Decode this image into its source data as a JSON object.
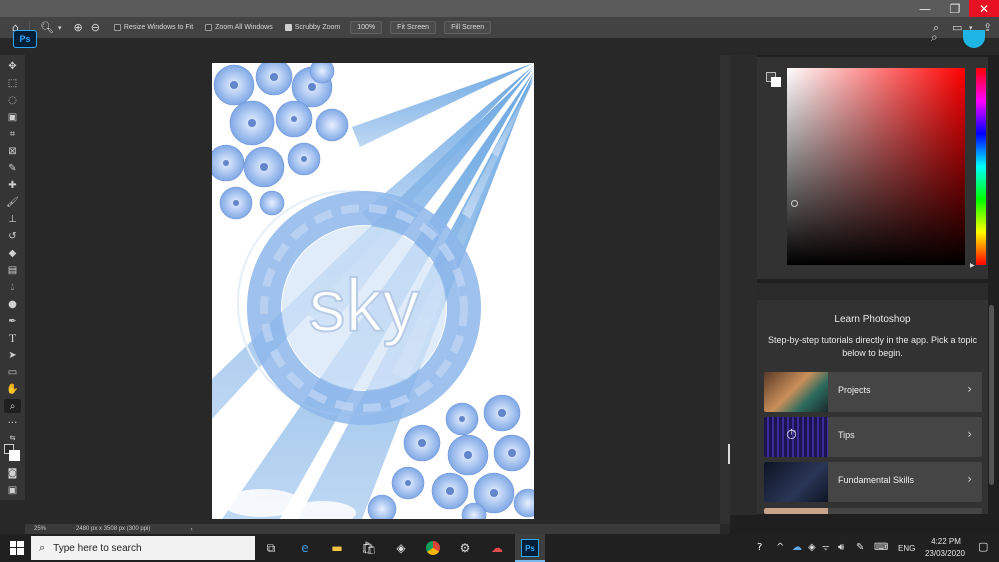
{
  "options_bar": {
    "resize_windows": "Resize Windows to Fit",
    "zoom_all": "Zoom All Windows",
    "scrubby_zoom": "Scrubby Zoom",
    "zoom_value": "100%",
    "fit_screen": "Fit Screen",
    "fill_screen": "Fill Screen"
  },
  "app": {
    "logo": "Ps"
  },
  "artwork": {
    "word": "sky"
  },
  "status_bar": {
    "zoom": "25%",
    "doc_info": "2480 px x 3508 px (300 ppi)",
    "arrow": "›"
  },
  "learn_panel": {
    "title": "Learn Photoshop",
    "subtitle": "Step-by-step tutorials directly in the app. Pick a topic below to begin.",
    "items": [
      {
        "label": "Projects"
      },
      {
        "label": "Tips"
      },
      {
        "label": "Fundamental Skills"
      }
    ]
  },
  "taskbar": {
    "search_placeholder": "Type here to search",
    "language": "ENG",
    "time": "4:22 PM",
    "date": "23/03/2020"
  },
  "colors": {
    "ps_blue": "#31a8ff",
    "close_red": "#e81123",
    "panel_bg": "#323232",
    "avatar": "#1fb6e6"
  }
}
